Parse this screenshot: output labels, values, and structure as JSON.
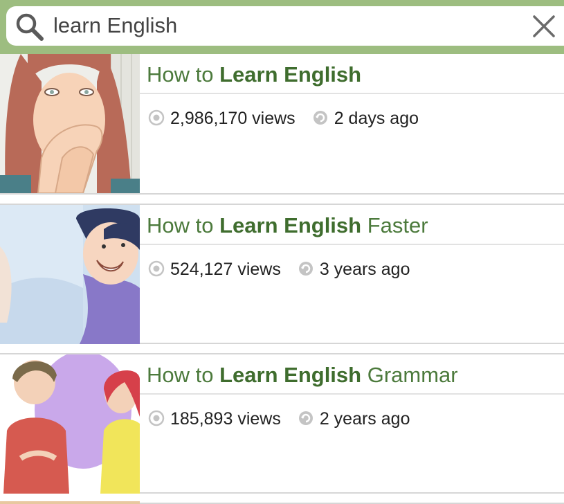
{
  "search": {
    "value": "learn English",
    "icon": "search-icon",
    "clear_icon": "close-icon"
  },
  "colors": {
    "accent": "#9dbd80",
    "title_green": "#4c7a3c"
  },
  "results": [
    {
      "title_prefix": "How to ",
      "title_bold": "Learn English",
      "title_suffix": "",
      "views": "2,986,170 views",
      "updated": "2 days ago"
    },
    {
      "title_prefix": "How to ",
      "title_bold": "Learn English",
      "title_suffix": " Faster",
      "views": "524,127 views",
      "updated": "3 years ago"
    },
    {
      "title_prefix": "How to ",
      "title_bold": "Learn English",
      "title_suffix": " Grammar",
      "views": "185,893 views",
      "updated": "2 years ago"
    }
  ]
}
